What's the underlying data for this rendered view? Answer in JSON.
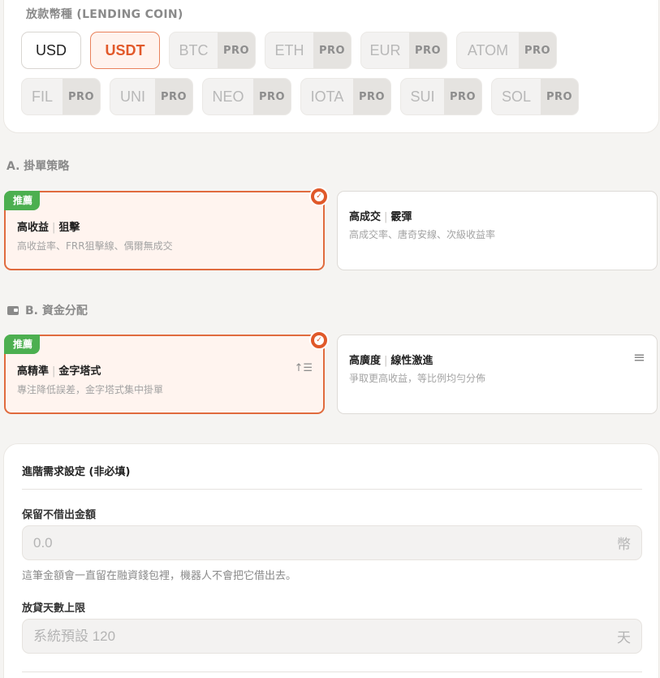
{
  "lending_coin": {
    "label": "放款幣種 (LENDING COIN)",
    "pro_label": "PRO",
    "coins": [
      {
        "name": "USD",
        "state": "available"
      },
      {
        "name": "USDT",
        "state": "selected"
      },
      {
        "name": "BTC",
        "state": "pro"
      },
      {
        "name": "ETH",
        "state": "pro"
      },
      {
        "name": "EUR",
        "state": "pro"
      },
      {
        "name": "ATOM",
        "state": "pro"
      },
      {
        "name": "FIL",
        "state": "pro"
      },
      {
        "name": "UNI",
        "state": "pro"
      },
      {
        "name": "NEO",
        "state": "pro"
      },
      {
        "name": "IOTA",
        "state": "pro"
      },
      {
        "name": "SUI",
        "state": "pro"
      },
      {
        "name": "SOL",
        "state": "pro"
      }
    ]
  },
  "strategy": {
    "heading": "A. 掛單策略",
    "options": [
      {
        "badge": "推薦",
        "title": "高收益",
        "subtitle": "狙擊",
        "desc": "高收益率、FRR狙擊線、偶爾無成交",
        "selected": true
      },
      {
        "badge": "",
        "title": "高成交",
        "subtitle": "霰彈",
        "desc": "高成交率、唐奇安線、次級收益率",
        "selected": false
      }
    ]
  },
  "allocation": {
    "heading": "B. 資金分配",
    "icon": "wallet-icon",
    "options": [
      {
        "badge": "推薦",
        "title": "高精準",
        "subtitle": "金字塔式",
        "desc": "專注降低誤差，金字塔式集中掛單",
        "icon": "↑☰",
        "selected": true
      },
      {
        "badge": "",
        "title": "高廣度",
        "subtitle": "線性激進",
        "desc": "爭取更高收益，等比例均勻分佈",
        "icon": "≡",
        "selected": false
      }
    ]
  },
  "advanced": {
    "title": "進階需求設定 (非必填)",
    "reserve": {
      "label": "保留不借出金額",
      "placeholder": "0.0",
      "unit": "幣",
      "hint": "這筆金額會一直留在融資錢包裡，機器人不會把它借出去。"
    },
    "max_days": {
      "label": "放貸天數上限",
      "placeholder": "系統預設 120",
      "unit": "天"
    }
  },
  "colors": {
    "accent": "#e2592a",
    "badge_green": "#4caf50"
  }
}
